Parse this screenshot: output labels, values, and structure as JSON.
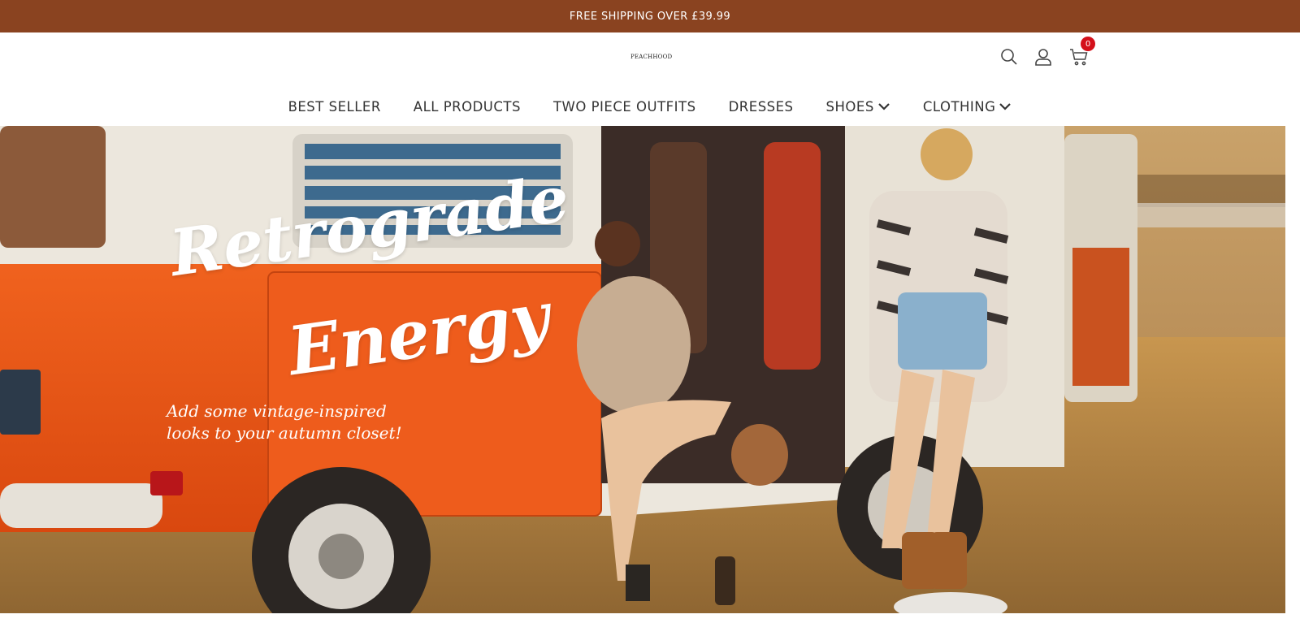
{
  "announcement": {
    "text": "FREE SHIPPING OVER  £39.99"
  },
  "header": {
    "logo_text": "PEACHHOOD",
    "cart_count": "0"
  },
  "nav": {
    "items": [
      {
        "label": "BEST SELLER",
        "dropdown": false
      },
      {
        "label": "ALL PRODUCTS",
        "dropdown": false
      },
      {
        "label": "TWO PIECE OUTFITS",
        "dropdown": false
      },
      {
        "label": "DRESSES",
        "dropdown": false
      },
      {
        "label": "SHOES",
        "dropdown": true
      },
      {
        "label": "CLOTHING",
        "dropdown": true
      }
    ]
  },
  "hero": {
    "title_line1": "Retrograde",
    "title_line2": "Energy",
    "subtitle": "Add some vintage-inspired looks to your autumn closet!"
  },
  "colors": {
    "announcement_bg": "#8a4320",
    "badge": "#d4101a",
    "van_orange": "#e8561a"
  },
  "icons": [
    "search-icon",
    "account-icon",
    "cart-icon",
    "chevron-down-icon"
  ]
}
